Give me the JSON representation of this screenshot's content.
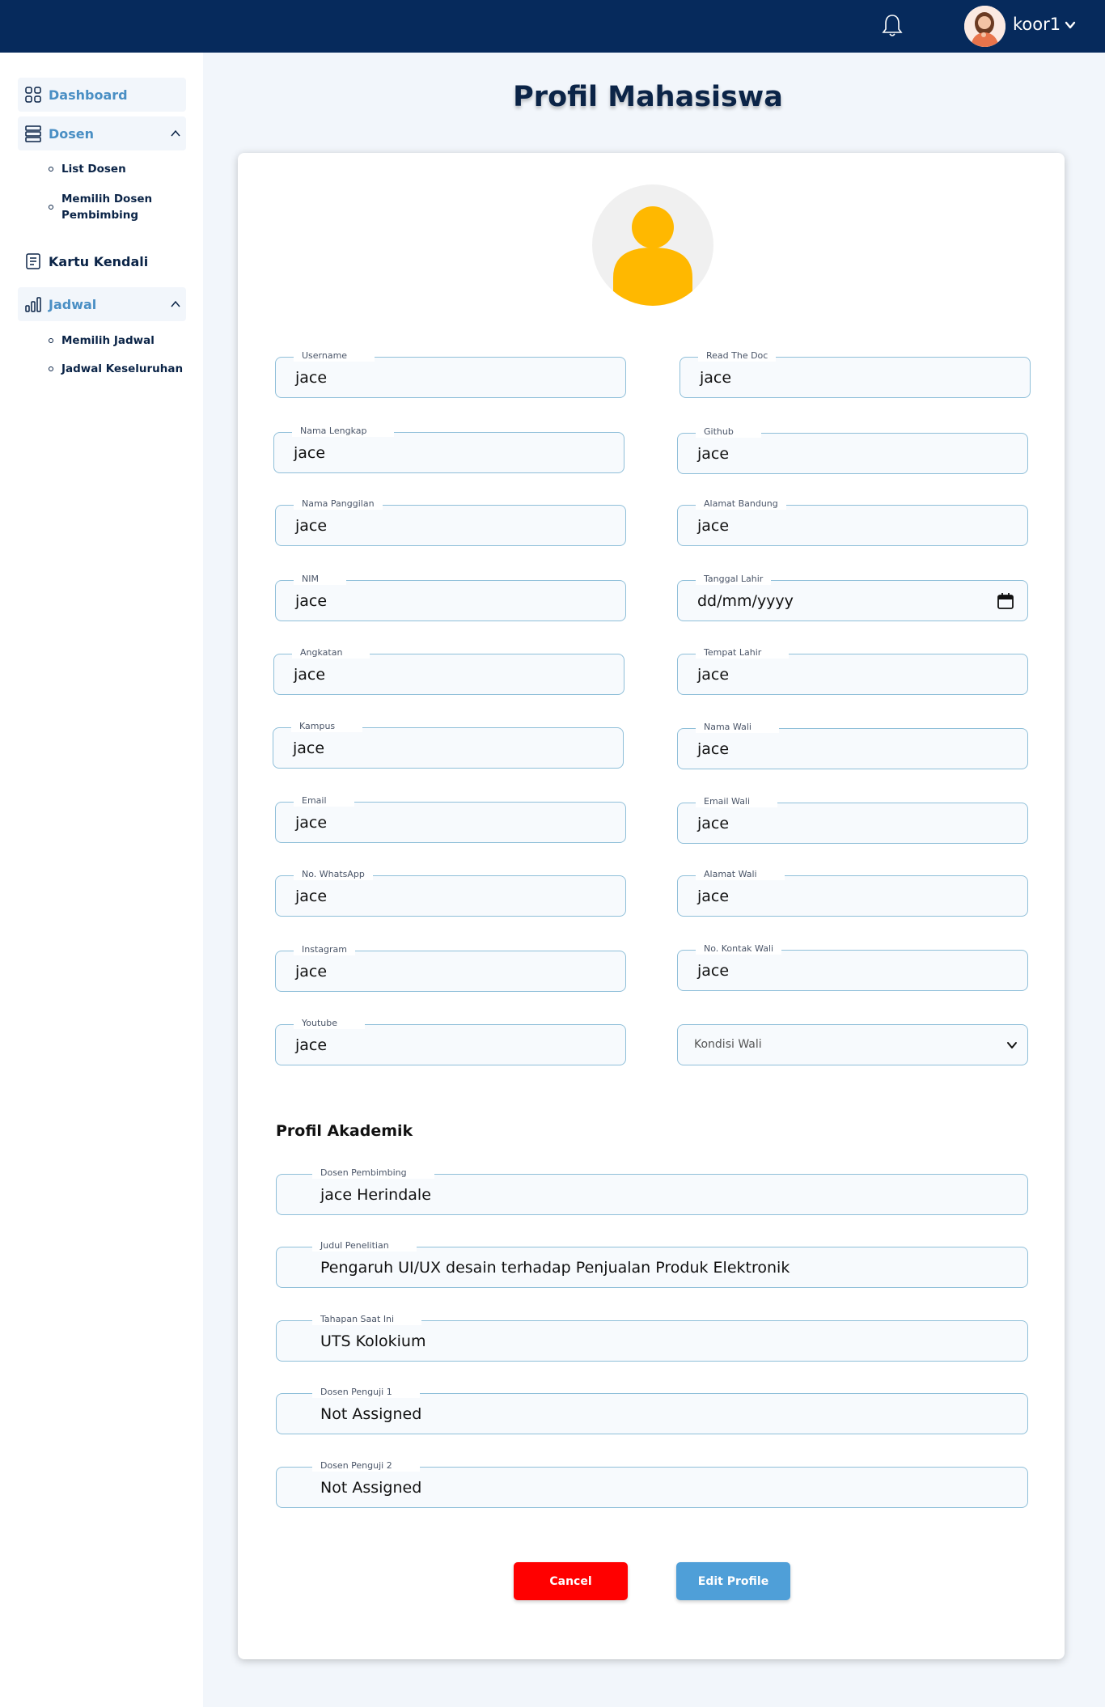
{
  "topbar": {
    "user_name": "koor1",
    "bell_icon": "bell-icon",
    "caret_icon": "chevron-down-icon"
  },
  "sidebar": {
    "dashboard": "Dashboard",
    "dosen": "Dosen",
    "dosen_items": [
      "List Dosen",
      "Memilih Dosen Pembimbing"
    ],
    "kartu_kendali": "Kartu Kendali",
    "jadwal": "Jadwal",
    "jadwal_items": [
      "Memilih Jadwal",
      "Jadwal Keseluruhan"
    ]
  },
  "page": {
    "title": "Profil Mahasiswa"
  },
  "form": {
    "left": [
      {
        "label": "Username",
        "value": "jace"
      },
      {
        "label": "Nama Lengkap",
        "value": "jace"
      },
      {
        "label": "Nama Panggilan",
        "value": "jace"
      },
      {
        "label": "NIM",
        "value": "jace"
      },
      {
        "label": "Angkatan",
        "value": "jace"
      },
      {
        "label": "Kampus",
        "value": "jace"
      },
      {
        "label": "Email",
        "value": "jace"
      },
      {
        "label": "No. WhatsApp",
        "value": "jace"
      },
      {
        "label": "Instagram",
        "value": "jace"
      },
      {
        "label": "Youtube",
        "value": "jace"
      }
    ],
    "right": [
      {
        "label": "Read The Doc",
        "value": "jace"
      },
      {
        "label": "Github",
        "value": "jace"
      },
      {
        "label": "Alamat Bandung",
        "value": "jace"
      },
      {
        "label": "Tanggal Lahir",
        "value": "dd/mm/yyyy"
      },
      {
        "label": "Tempat Lahir",
        "value": "jace"
      },
      {
        "label": "Nama Wali",
        "value": "jace"
      },
      {
        "label": "Email Wali",
        "value": "jace"
      },
      {
        "label": "Alamat Wali",
        "value": "jace"
      },
      {
        "label": "No. Kontak Wali",
        "value": "jace"
      }
    ],
    "kondisi_wali": {
      "selected": "Kondisi Wali"
    }
  },
  "akademik": {
    "title": "Profil Akademik",
    "fields": [
      {
        "label": "Dosen Pembimbing",
        "value": "jace Herindale"
      },
      {
        "label": "Judul Penelitian",
        "value": "Pengaruh UI/UX desain terhadap Penjualan Produk Elektronik"
      },
      {
        "label": "Tahapan Saat Ini",
        "value": "UTS Kolokium"
      },
      {
        "label": "Dosen Penguji 1",
        "value": "Not Assigned"
      },
      {
        "label": "Dosen Penguji 2",
        "value": "Not Assigned"
      }
    ]
  },
  "buttons": {
    "cancel": "Cancel",
    "edit": "Edit Profile"
  },
  "colors": {
    "header": "#062a5c",
    "accent": "#4a8fc4",
    "cancel": "#ff0000",
    "edit": "#4f9fd8",
    "avatar": "#ffb800"
  }
}
